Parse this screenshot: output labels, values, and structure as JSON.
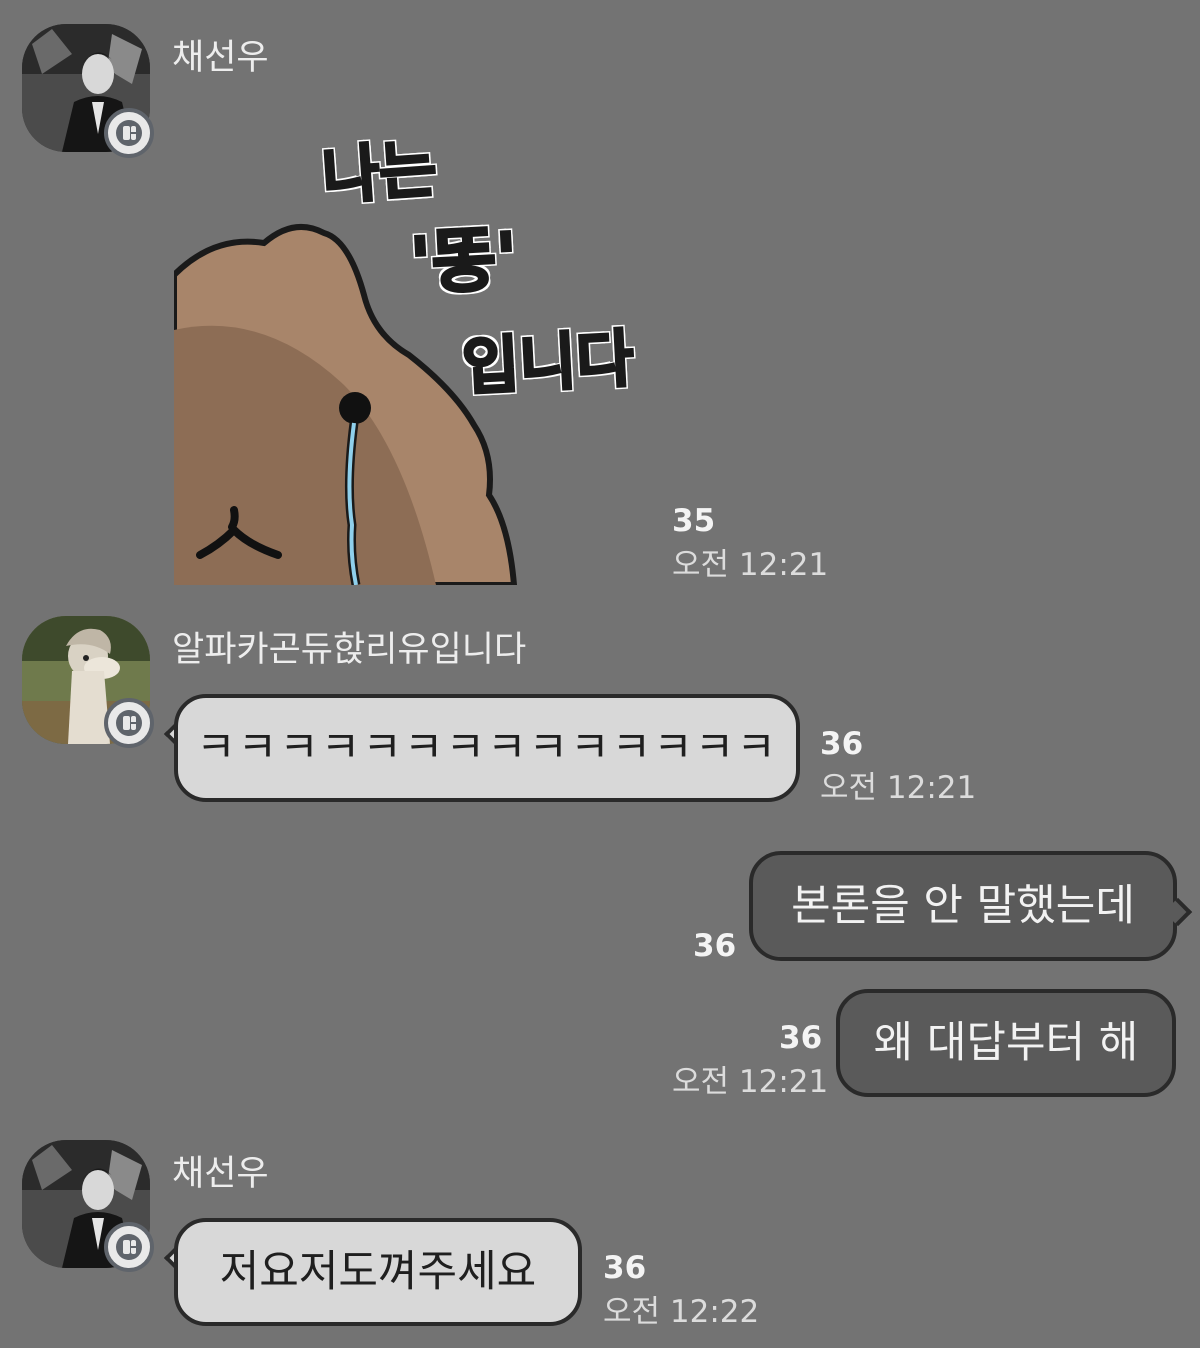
{
  "messages": [
    {
      "sender": "채선우",
      "sticker": {
        "text_line1": "나는",
        "text_line2": "'똥'",
        "text_line3": "입니다"
      },
      "count": "35",
      "time": "오전 12:21"
    },
    {
      "sender": "알파카곤듀핝리유입니다",
      "text": "ㅋㅋㅋㅋㅋㅋㅋㅋㅋㅋㅋㅋㅋㅋ",
      "count": "36",
      "time": "오전 12:21"
    },
    {
      "sender": "me",
      "text": "본론을 안 말했는데",
      "count": "36"
    },
    {
      "sender": "me",
      "text": "왜 대답부터 해",
      "count": "36",
      "time": "오전 12:21"
    },
    {
      "sender": "채선우",
      "text": "저요저도껴주세요",
      "count": "36",
      "time": "오전 12:22"
    }
  ],
  "colors": {
    "background": "#737373",
    "incoming_bubble": "#d8d8d8",
    "outgoing_bubble": "#5a5a5a",
    "poop_brown": "#a8856a",
    "tear_blue": "#8fd0ec"
  }
}
